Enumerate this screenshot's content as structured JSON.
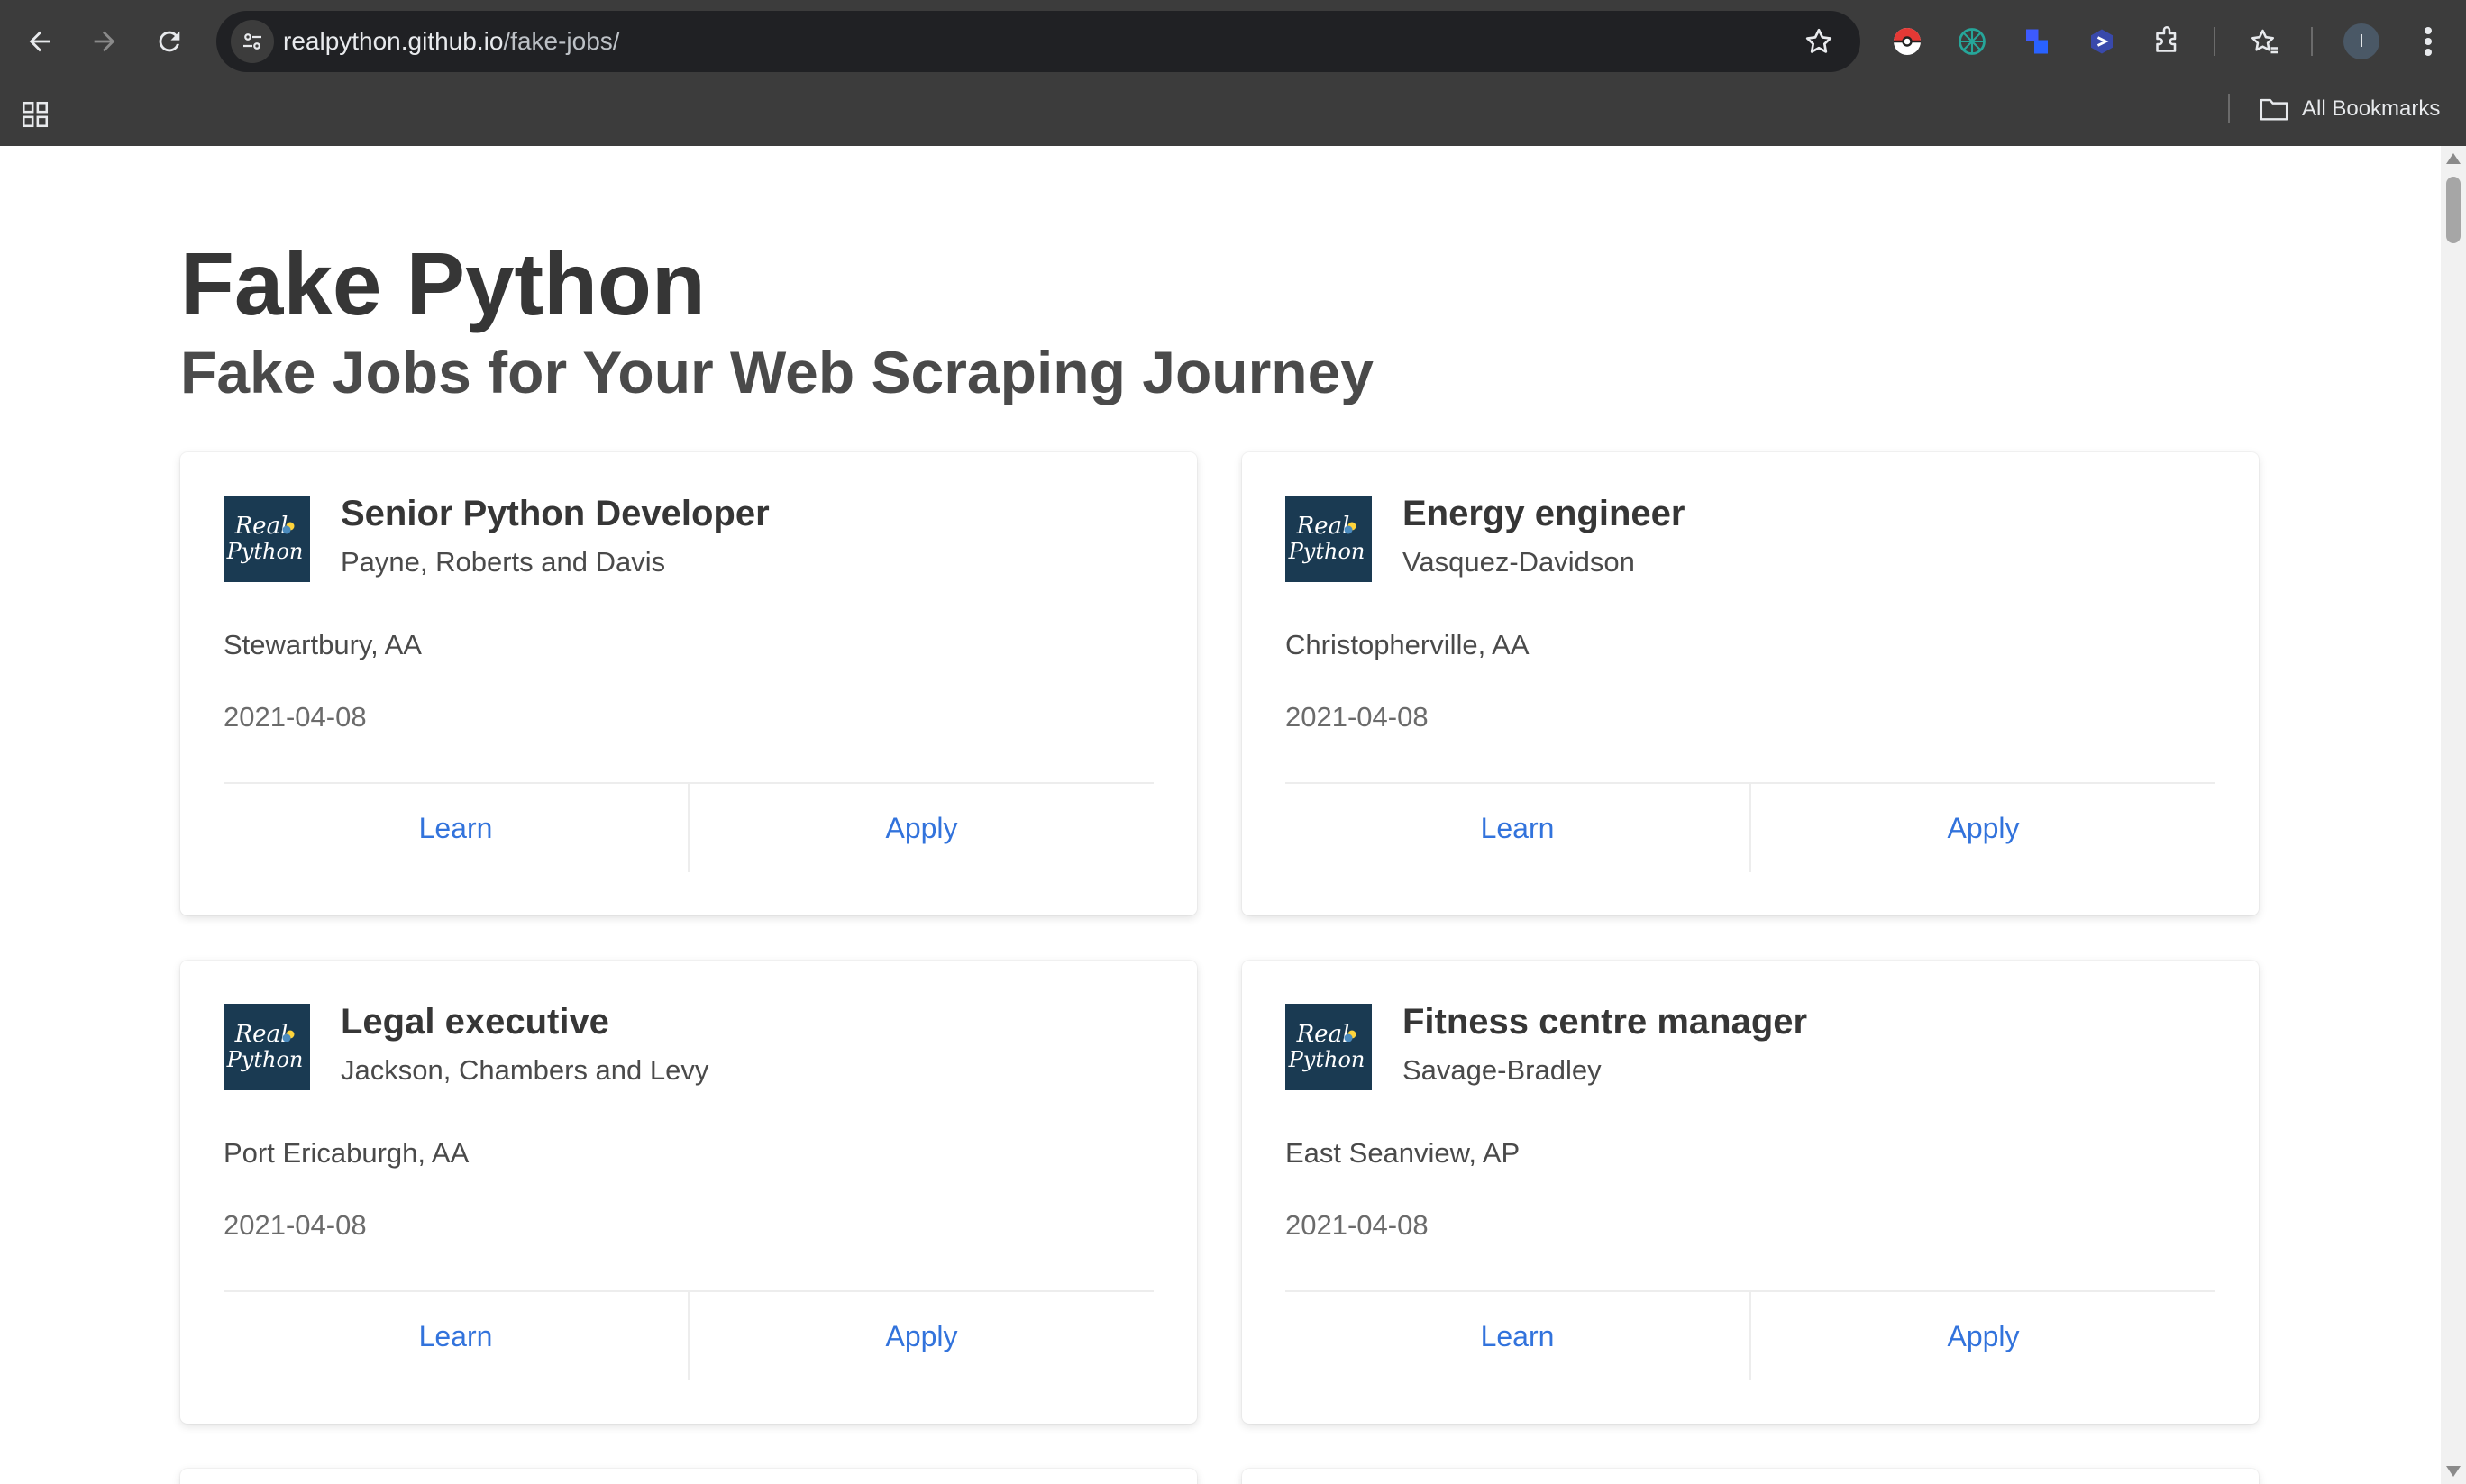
{
  "browser": {
    "url_host": "realpython.github.io",
    "url_path": "/fake-jobs/",
    "avatar_initial": "I",
    "all_bookmarks_label": "All Bookmarks",
    "icons": [
      "back-arrow-icon",
      "forward-arrow-icon",
      "reload-icon",
      "site-settings-icon",
      "bookmark-star-icon",
      "pokeball-extension-icon",
      "network-extension-icon",
      "blue-squares-extension-icon",
      "hexagon-extension-icon",
      "extensions-puzzle-icon",
      "reading-list-icon",
      "more-menu-icon",
      "apps-grid-icon",
      "folder-icon"
    ]
  },
  "page": {
    "title": "Fake Python",
    "subtitle": "Fake Jobs for Your Web Scraping Journey"
  },
  "jobs": [
    {
      "title": "Senior Python Developer",
      "company": "Payne, Roberts and Davis",
      "location": "Stewartbury, AA",
      "date": "2021-04-08",
      "learn": "Learn",
      "apply": "Apply"
    },
    {
      "title": "Energy engineer",
      "company": "Vasquez-Davidson",
      "location": "Christopherville, AA",
      "date": "2021-04-08",
      "learn": "Learn",
      "apply": "Apply"
    },
    {
      "title": "Legal executive",
      "company": "Jackson, Chambers and Levy",
      "location": "Port Ericaburgh, AA",
      "date": "2021-04-08",
      "learn": "Learn",
      "apply": "Apply"
    },
    {
      "title": "Fitness centre manager",
      "company": "Savage-Bradley",
      "location": "East Seanview, AP",
      "date": "2021-04-08",
      "learn": "Learn",
      "apply": "Apply"
    }
  ],
  "logo": {
    "line1": "Real",
    "line2": "Python",
    "background": "#1a3a52"
  },
  "colors": {
    "link": "#3273dc",
    "chrome": "#3c3c3c",
    "omnibox": "#202124"
  }
}
